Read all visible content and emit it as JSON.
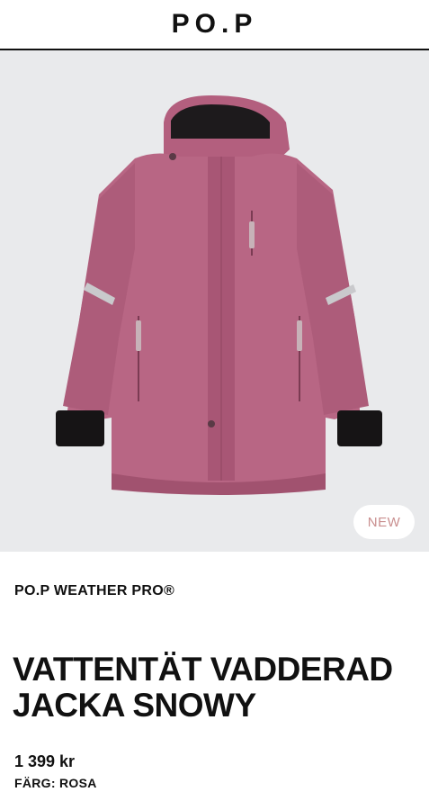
{
  "header": {
    "logo": "PO.P"
  },
  "product": {
    "image_alt": "Pink padded winter jacket",
    "badge": "NEW",
    "brand_line": "PO.P WEATHER PRO®",
    "title": "VATTENTÄT VADDERAD JACKA SNOWY",
    "price": "1 399 kr",
    "color_label": "FÄRG: ROSA"
  },
  "colors": {
    "jacket": "#b86684",
    "background": "#e9eaec",
    "badge_text": "#c98f8f"
  }
}
